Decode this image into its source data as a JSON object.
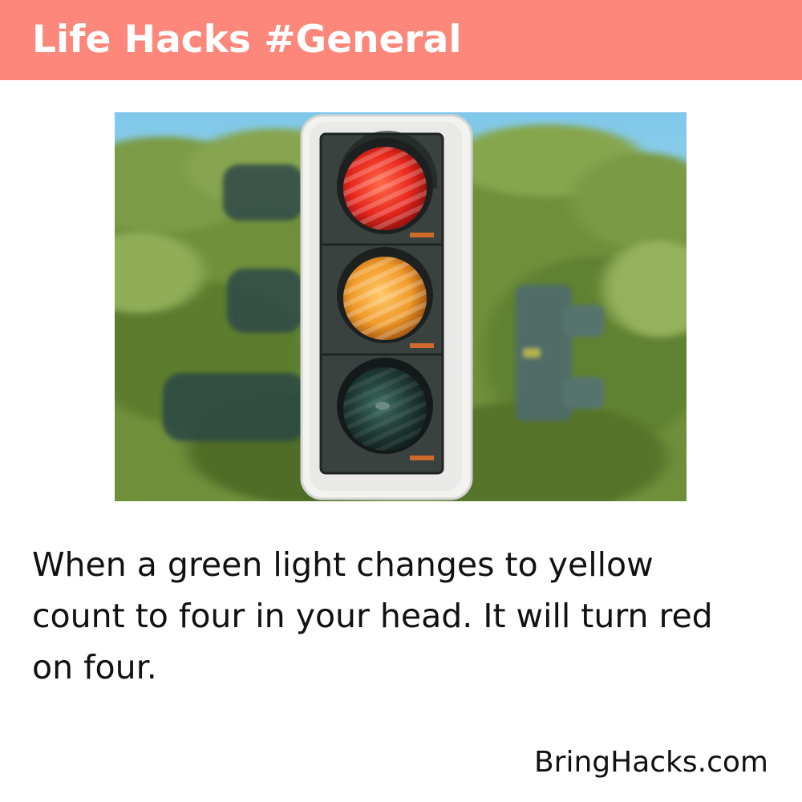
{
  "header": {
    "title": "Life Hacks #General",
    "background_color": "#fc877a"
  },
  "photo": {
    "subject_icon": "traffic-light-icon",
    "lamps": [
      {
        "name": "red-lamp",
        "color": "#e8281e"
      },
      {
        "name": "yellow-lamp",
        "color": "#f09a2a"
      },
      {
        "name": "green-lamp",
        "color": "#1f3a35"
      }
    ]
  },
  "content": {
    "hack_text": "When a green light changes to yellow count to four in your head. It will turn red on four."
  },
  "footer": {
    "site": "BringHacks.com"
  }
}
